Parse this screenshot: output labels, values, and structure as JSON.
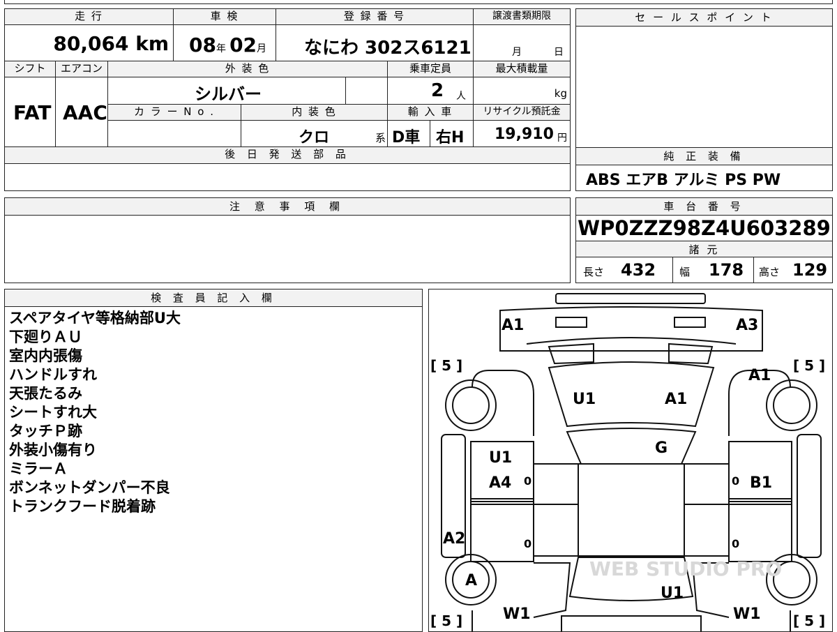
{
  "info": {
    "mileage_label": "走 行",
    "mileage": "80,064 km",
    "inspection_label": "車 検",
    "inspection_year": "08",
    "inspection_year_unit": "年",
    "inspection_month": "02",
    "inspection_month_unit": "月",
    "registration_label": "登 録 番 号",
    "registration": "なにわ 302ス6121",
    "transfer_label": "譲渡書類期限",
    "transfer_month": "月",
    "transfer_day": "日",
    "shift_label": "シフト",
    "shift": "FAT",
    "aircon_label": "エアコン",
    "aircon": "AAC",
    "exterior_label": "外 装 色",
    "exterior": "シルバー",
    "color_no_label": "カ ラ ー N o .",
    "interior_label": "内 装 色",
    "interior": "クロ",
    "interior_suffix": "系",
    "capacity_label": "乗車定員",
    "capacity": "2",
    "capacity_unit": "人",
    "load_label": "最大積載量",
    "load_unit": "kg",
    "import_label": "輸 入 車",
    "import_type": "D車",
    "steering": "右H",
    "recycle_label": "リサイクル預託金",
    "recycle": "19,910",
    "recycle_unit": "円",
    "parts_label": "後 日 発 送 部 品"
  },
  "sales_point_label": "セ ー ル ス ポ イ ン ト",
  "equipment_label": "純 正 装 備",
  "equipment": "ABS エアB アルミ PS PW",
  "notes_label": "注 意 事 項 欄",
  "chassis_label": "車 台 番 号",
  "chassis": "WP0ZZZ98Z4U603289",
  "specs_label": "諸 元",
  "length_label": "長さ",
  "length": "432",
  "width_label": "幅",
  "width": "178",
  "height_label": "高さ",
  "height": "129",
  "inspector_label": "検 査 員 記 入 欄",
  "remarks": [
    "スペアタイヤ等格納部U大",
    "下廻りＡＵ",
    "室内内張傷",
    "ハンドルすれ",
    "天張たるみ",
    "シートすれ大",
    "タッチＰ跡",
    "外装小傷有り",
    "ミラーＡ",
    "ボンネットダンパー不良",
    "トランクフード脱着跡"
  ],
  "diagram": {
    "marks": [
      "A1",
      "A3",
      "A1",
      "U1",
      "A1",
      "G",
      "U1",
      "A4",
      "B1",
      "A2",
      "A",
      "U1",
      "W1",
      "W1"
    ],
    "tire_label_fl": "[ 5 ]",
    "tire_label_fr": "[ 5 ]",
    "tire_label_rl": "[ 5 ]",
    "tire_label_rr": "[ 5 ]",
    "zero": "0",
    "watermark": "WEB STUDIO PRO"
  }
}
